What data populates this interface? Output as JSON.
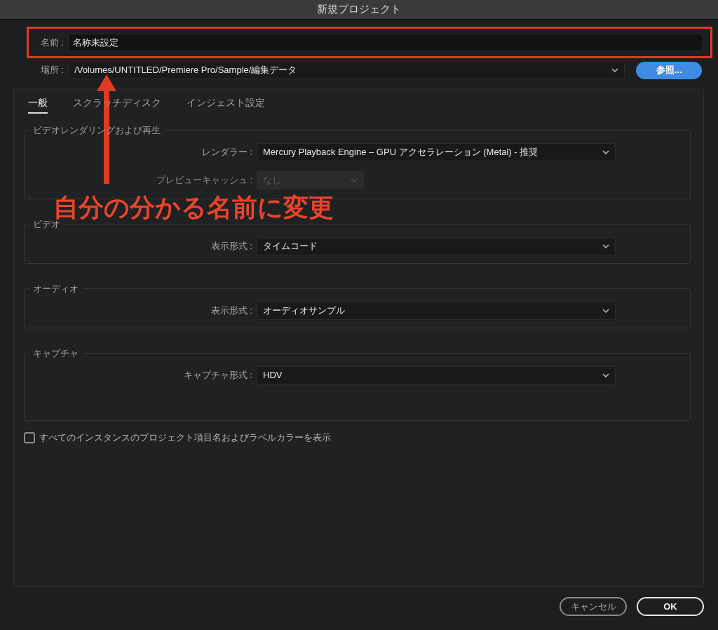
{
  "window": {
    "title": "新規プロジェクト"
  },
  "name_field": {
    "label": "名前 :",
    "value": "名称未設定"
  },
  "location": {
    "label": "場所 :",
    "value": "/Volumes/UNTITLED/Premiere Pro/Sample/編集データ",
    "button": "参照..."
  },
  "tabs": [
    {
      "label": "一般",
      "selected": true
    },
    {
      "label": "スクラッチディスク",
      "selected": false
    },
    {
      "label": "インジェスト設定",
      "selected": false
    }
  ],
  "sections": [
    {
      "title": "ビデオレンダリングおよび再生",
      "rows": [
        {
          "label": "レンダラー :",
          "value": "Mercury Playback Engine – GPU アクセラレーション (Metal) - 推奨",
          "disabled": false
        },
        {
          "label": "プレビューキャッシュ :",
          "value": "なし",
          "disabled": true
        }
      ]
    },
    {
      "title": "ビデオ",
      "rows": [
        {
          "label": "表示形式 :",
          "value": "タイムコード",
          "disabled": false
        }
      ]
    },
    {
      "title": "オーディオ",
      "rows": [
        {
          "label": "表示形式 :",
          "value": "オーディオサンプル",
          "disabled": false
        }
      ]
    },
    {
      "title": "キャプチャ",
      "rows": [
        {
          "label": "キャプチャ形式 :",
          "value": "HDV",
          "disabled": false
        }
      ]
    }
  ],
  "checkbox": {
    "label": "すべてのインスタンスのプロジェクト項目名およびラベルカラーを表示",
    "checked": false
  },
  "buttons": [
    {
      "label": "キャンセル",
      "kind": "secondary"
    },
    {
      "label": "OK",
      "kind": "primary"
    }
  ],
  "annotation": {
    "text": "自分の分かる名前に変更"
  }
}
